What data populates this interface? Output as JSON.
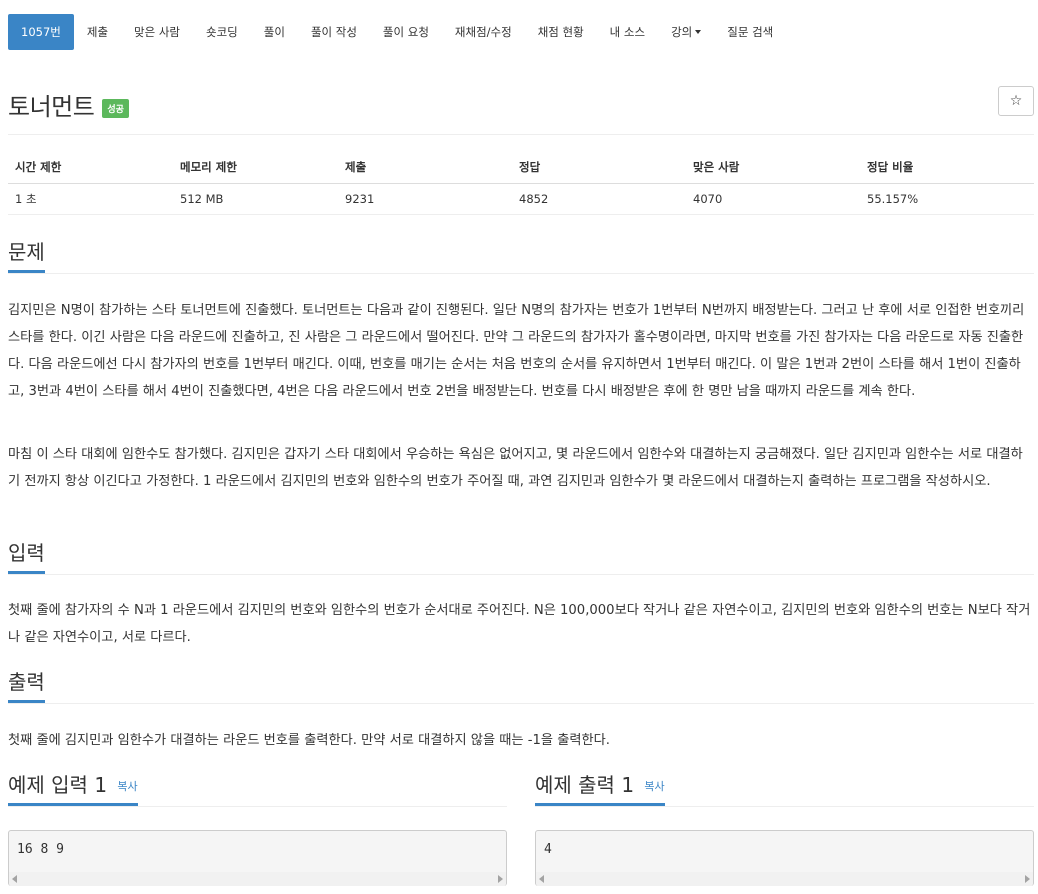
{
  "nav": {
    "items": [
      {
        "label": "1057번",
        "active": true
      },
      {
        "label": "제출"
      },
      {
        "label": "맞은 사람"
      },
      {
        "label": "숏코딩"
      },
      {
        "label": "풀이"
      },
      {
        "label": "풀이 작성"
      },
      {
        "label": "풀이 요청"
      },
      {
        "label": "재채점/수정"
      },
      {
        "label": "채점 현황"
      },
      {
        "label": "내 소스"
      },
      {
        "label": "강의"
      },
      {
        "label": "질문 검색"
      }
    ]
  },
  "problem": {
    "title": "토너먼트",
    "status_badge": "성공",
    "star_icon": "☆"
  },
  "info_table": {
    "headers": [
      "시간 제한",
      "메모리 제한",
      "제출",
      "정답",
      "맞은 사람",
      "정답 비율"
    ],
    "row": [
      "1 초",
      "512 MB",
      "9231",
      "4852",
      "4070",
      "55.157%"
    ]
  },
  "sections": {
    "description": {
      "heading": "문제",
      "paragraphs": [
        "김지민은 N명이 참가하는 스타 토너먼트에 진출했다. 토너먼트는 다음과 같이 진행된다. 일단 N명의 참가자는 번호가 1번부터 N번까지 배정받는다. 그러고 난 후에 서로 인접한 번호끼리 스타를 한다. 이긴 사람은 다음 라운드에 진출하고, 진 사람은 그 라운드에서 떨어진다. 만약 그 라운드의 참가자가 홀수명이라면, 마지막 번호를 가진 참가자는 다음 라운드로 자동 진출한다. 다음 라운드에선 다시 참가자의 번호를 1번부터 매긴다. 이때, 번호를 매기는 순서는 처음 번호의 순서를 유지하면서 1번부터 매긴다. 이 말은 1번과 2번이 스타를 해서 1번이 진출하고, 3번과 4번이 스타를 해서 4번이 진출했다면, 4번은 다음 라운드에서 번호 2번을 배정받는다. 번호를 다시 배정받은 후에 한 명만 남을 때까지 라운드를 계속 한다.",
        "마침 이 스타 대회에 임한수도 참가했다. 김지민은 갑자기 스타 대회에서 우승하는 욕심은 없어지고, 몇 라운드에서 임한수와 대결하는지 궁금해졌다. 일단 김지민과 임한수는 서로 대결하기 전까지 항상 이긴다고 가정한다. 1 라운드에서 김지민의 번호와 임한수의 번호가 주어질 때, 과연 김지민과 임한수가 몇 라운드에서 대결하는지 출력하는 프로그램을 작성하시오."
      ]
    },
    "input": {
      "heading": "입력",
      "text": "첫째 줄에 참가자의 수 N과 1 라운드에서 김지민의 번호와 임한수의 번호가 순서대로 주어진다. N은 100,000보다 작거나 같은 자연수이고, 김지민의 번호와 임한수의 번호는 N보다 작거나 같은 자연수이고, 서로 다르다."
    },
    "output": {
      "heading": "출력",
      "text": "첫째 줄에 김지민과 임한수가 대결하는 라운드 번호를 출력한다. 만약 서로 대결하지 않을 때는 -1을 출력한다."
    }
  },
  "samples": {
    "input": {
      "heading": "예제 입력 1",
      "copy_label": "복사",
      "content": "16 8 9"
    },
    "output": {
      "heading": "예제 출력 1",
      "copy_label": "복사",
      "content": "4"
    }
  },
  "colors": {
    "accent": "#3a85c6",
    "success": "#5cb85c"
  }
}
